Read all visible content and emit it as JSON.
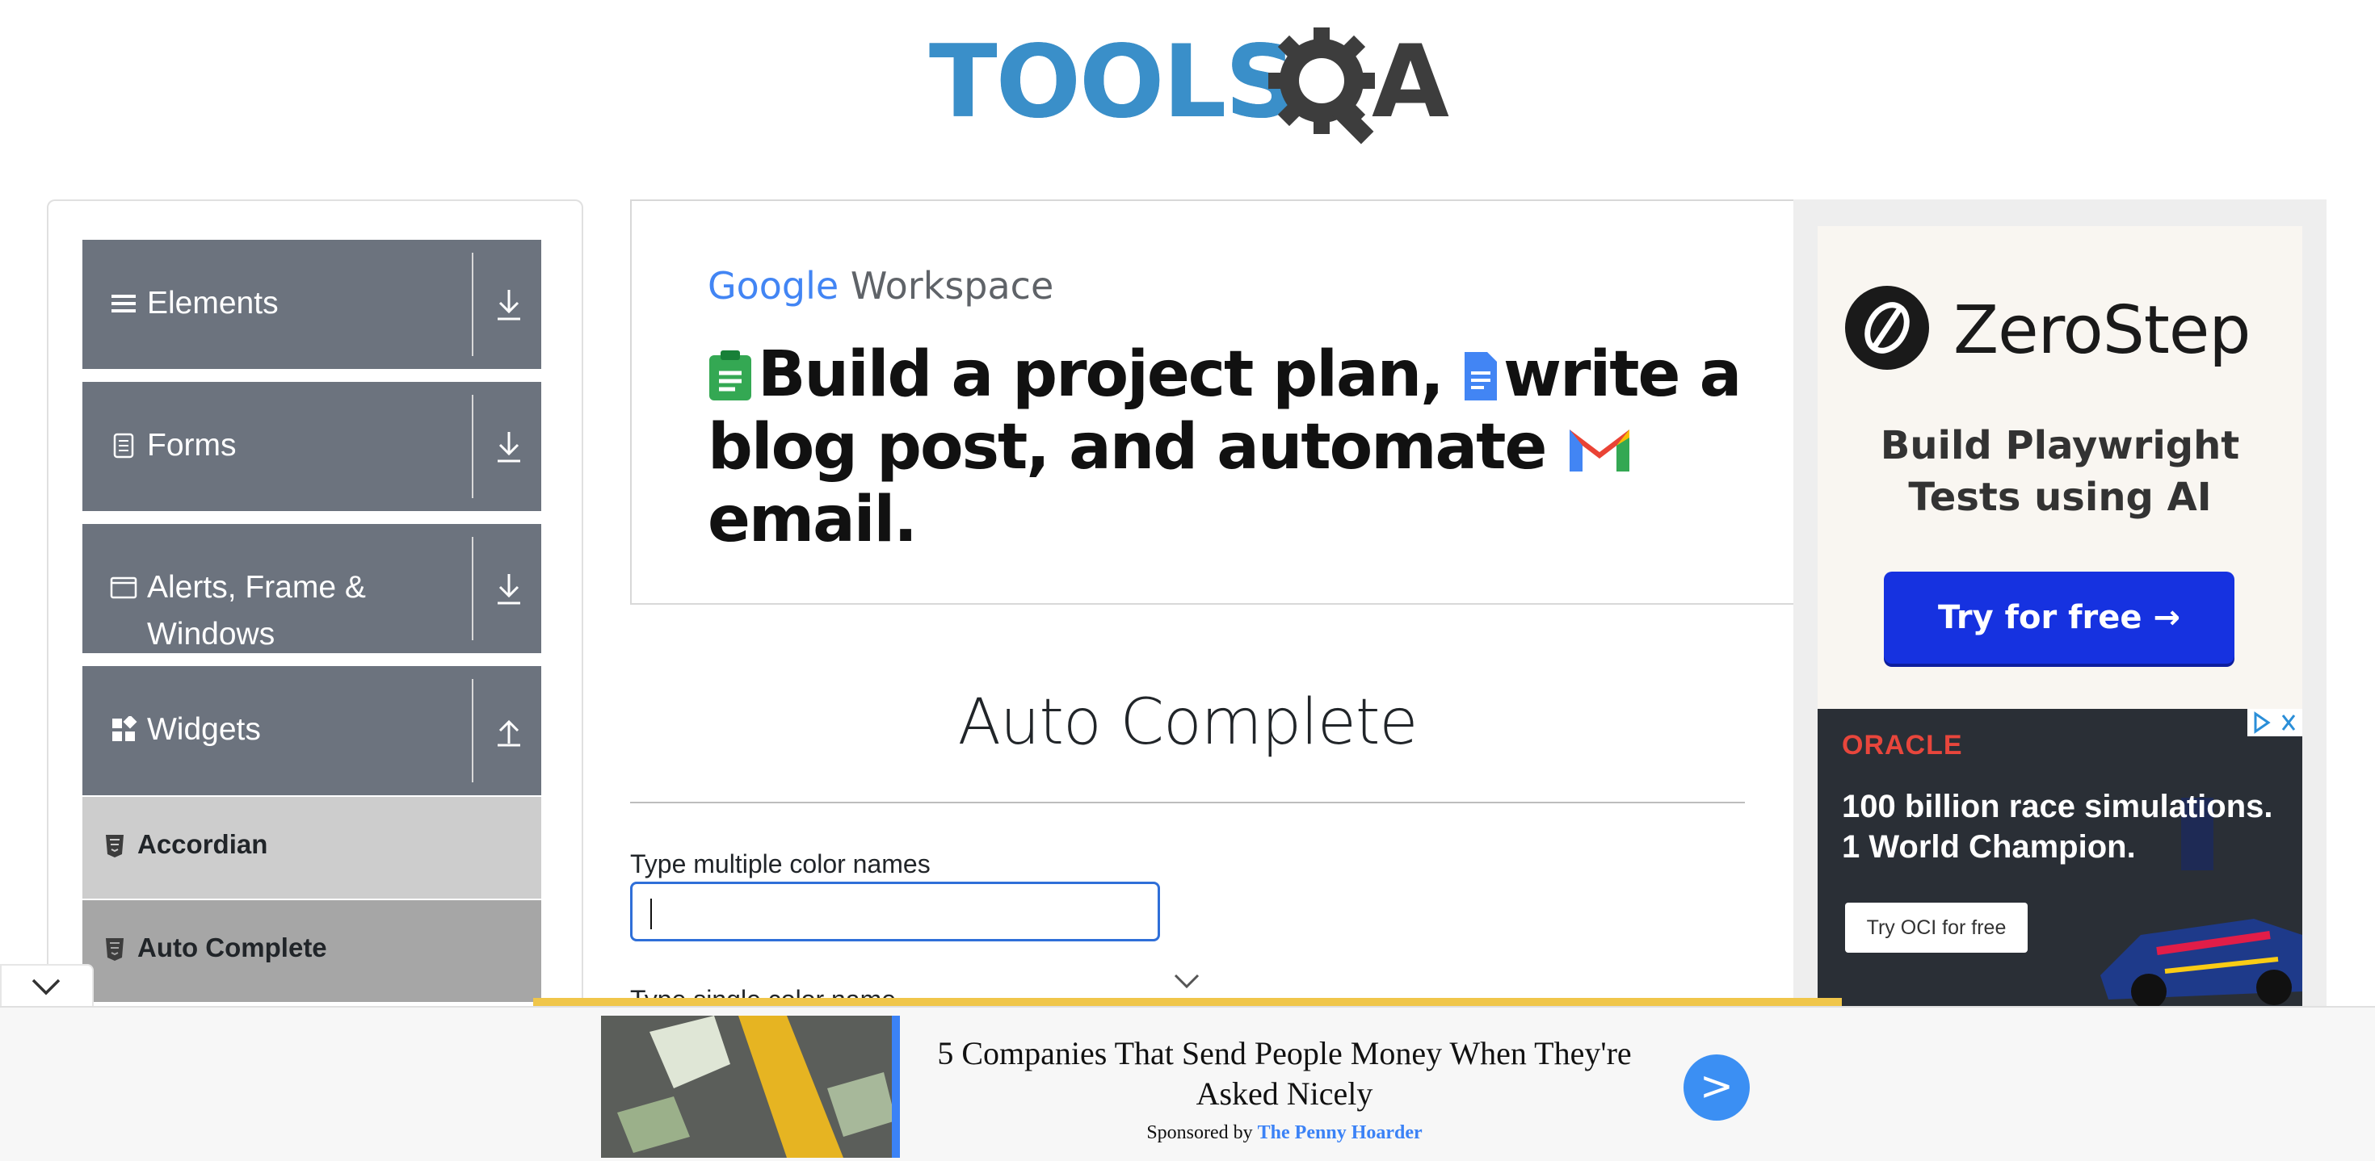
{
  "header": {
    "logo_text": "TOOLS",
    "logo_suffix": "A"
  },
  "sidebar": {
    "groups": [
      {
        "label": "Elements",
        "icon": "hamburger-icon",
        "arrow": "download-arrow-icon"
      },
      {
        "label": "Forms",
        "icon": "document-icon",
        "arrow": "download-arrow-icon"
      },
      {
        "label": "Alerts, Frame &",
        "label2": "Windows",
        "icon": "window-icon",
        "arrow": "download-arrow-icon"
      },
      {
        "label": "Widgets",
        "icon": "widgets-icon",
        "arrow": "upload-arrow-icon"
      }
    ],
    "items": [
      {
        "label": "Accordian",
        "icon": "html5-icon"
      },
      {
        "label": "Auto Complete",
        "icon": "html5-icon"
      }
    ]
  },
  "ad_google": {
    "brand_g": "Google",
    "brand_w": "Workspace",
    "headline_1": "Build a project plan,",
    "headline_2": "write a",
    "headline_3": "blog post, and automate",
    "headline_4": "email."
  },
  "ad_zerostep": {
    "brand": "ZeroStep",
    "tagline_1": "Build Playwright",
    "tagline_2": "Tests using AI",
    "cta": "Try for free →"
  },
  "ad_oracle": {
    "brand": "ORACLE",
    "line_1": "100 billion race simulations.",
    "line_2": "1 World Champion.",
    "cta": "Try OCI for free"
  },
  "main": {
    "title": "Auto Complete",
    "multi_label": "Type multiple color names",
    "single_label": "Type single color name"
  },
  "bottom_ad": {
    "headline": "5 Companies That Send People Money When They're Asked Nicely",
    "sponsored_by": "Sponsored by",
    "sponsor": "The Penny Hoarder",
    "go": ">"
  },
  "colors": {
    "sidebar_header": "#6c737e",
    "input_focus": "#2f6fd8",
    "zerostep_button": "#1632e0",
    "sponsor_link": "#3b82f6"
  }
}
